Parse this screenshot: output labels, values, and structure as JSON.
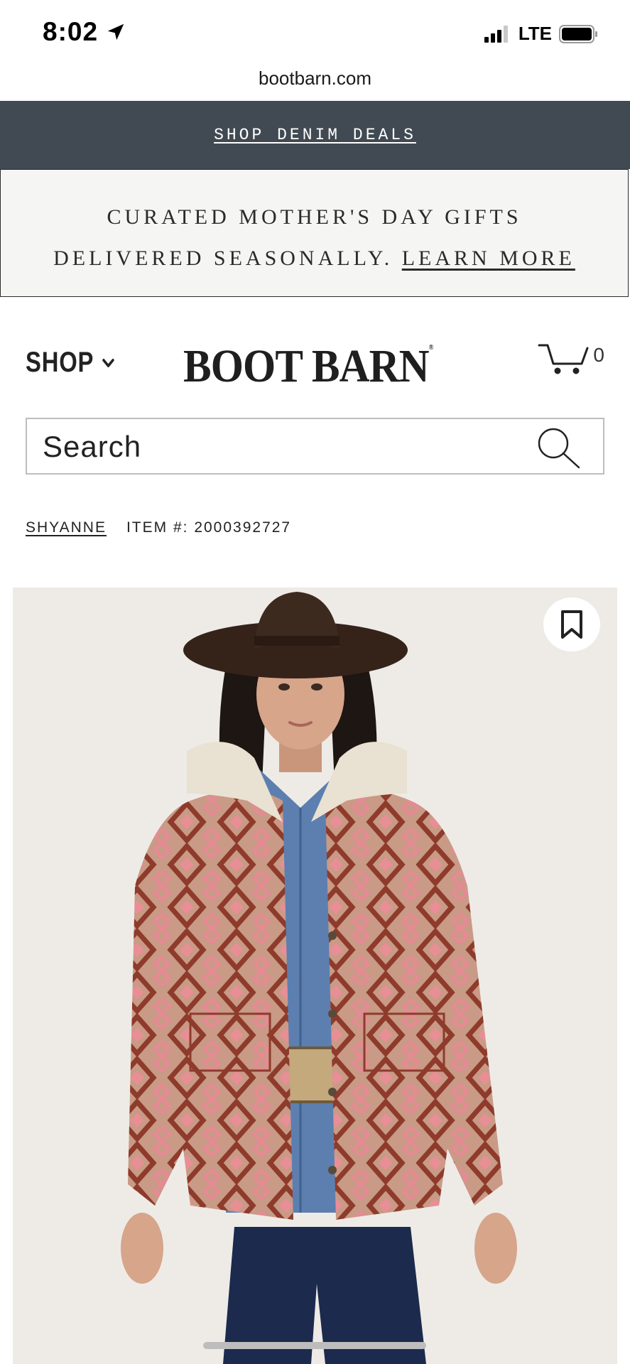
{
  "status_bar": {
    "time": "8:02",
    "network": "LTE",
    "icons": [
      "location-arrow-icon",
      "signal-icon",
      "battery-icon"
    ]
  },
  "browser": {
    "url": "bootbarn.com"
  },
  "promo_banner": {
    "text": "SHOP DENIM DEALS"
  },
  "promo_message": {
    "line1": "CURATED MOTHER'S DAY GIFTS",
    "line2": "DELIVERED SEASONALLY.",
    "link": "LEARN MORE"
  },
  "header": {
    "shop_label": "SHOP",
    "logo": "BOOT BARN",
    "logo_mark": "®",
    "cart_count": "0",
    "icons": [
      "chevron-down-icon",
      "cart-icon"
    ]
  },
  "search": {
    "placeholder": "Search",
    "icon": "search-icon"
  },
  "product": {
    "brand": "SHYANNE",
    "item_number": "ITEM #: 2000392727",
    "image_alt": "Shyanne southwestern print shacket with sherpa collar",
    "icons": [
      "bookmark-icon"
    ]
  },
  "colors": {
    "promo_dark_bg": "#414a52",
    "promo_light_bg": "#f5f5f3",
    "image_bg": "#eeebe7"
  }
}
